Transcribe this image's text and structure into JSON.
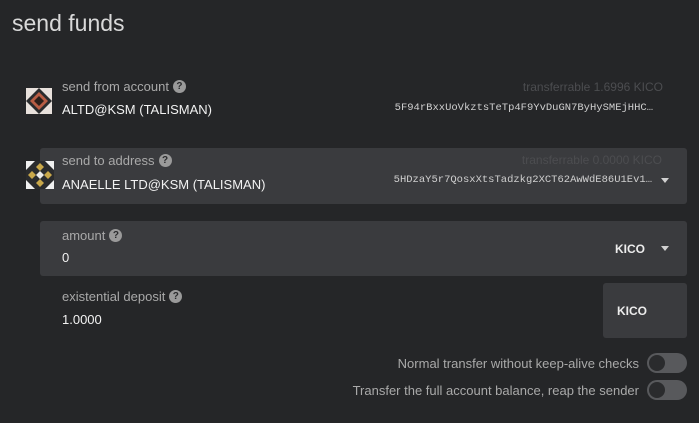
{
  "page": {
    "title": "send funds"
  },
  "from": {
    "label": "send from account",
    "account_name": "ALTD@KSM (TALISMAN)",
    "address": "5F94rBxxUoVkztsTeTp4F9YvDuGN7ByHySMEjHHC…",
    "transferrable": "transferrable 1.6996 KICO"
  },
  "to": {
    "label": "send to address",
    "account_name": "ANAELLE LTD@KSM (TALISMAN)",
    "address": "5HDzaY5r7QosxXtsTadzkg2XCT62AwWdE86U1Ev1…",
    "transferrable": "transferrable 0.0000 KICO"
  },
  "amount": {
    "label": "amount",
    "value": "0",
    "unit": "KICO"
  },
  "deposit": {
    "label": "existential deposit",
    "value": "1.0000",
    "unit": "KICO"
  },
  "options": {
    "keep_alive_label": "Normal transfer without keep-alive checks",
    "reap_label": "Transfer the full account balance, reap the sender"
  },
  "icons": {
    "help": "help-icon",
    "dropdown": "chevron-down-icon"
  }
}
